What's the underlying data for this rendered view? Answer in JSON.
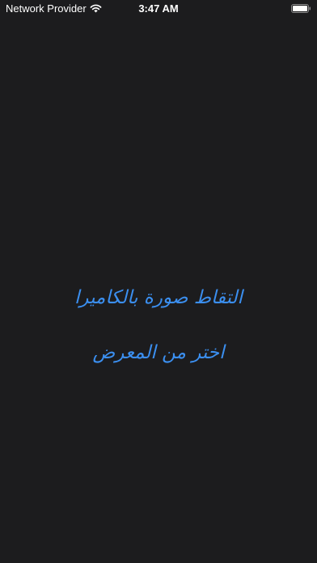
{
  "status_bar": {
    "carrier": "Network Provider",
    "time": "3:47 AM",
    "wifi_icon": "wifi-icon",
    "battery_icon": "battery-icon"
  },
  "actions": {
    "camera_label": "التقاط صورة بالكاميرا",
    "gallery_label": "اختر من المعرض"
  },
  "colors": {
    "background": "#1c1c1e",
    "accent": "#3b8ff0",
    "status_text": "#ffffff"
  }
}
